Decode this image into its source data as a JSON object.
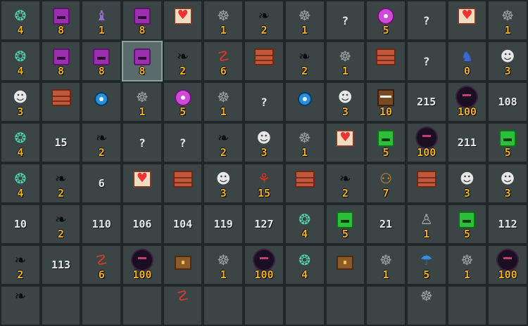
{
  "rows": [
    [
      {
        "icon": "gargoyle-icon",
        "value": "4"
      },
      {
        "icon": "purple-slime-icon",
        "value": "8"
      },
      {
        "icon": "robed-wizard-icon",
        "value": "1"
      },
      {
        "icon": "purple-slime-icon",
        "value": "8"
      },
      {
        "icon": "heart-icon",
        "value": ""
      },
      {
        "icon": "rat-icon",
        "value": "1"
      },
      {
        "icon": "bat-icon",
        "value": "2"
      },
      {
        "icon": "rat-icon",
        "value": "1"
      },
      {
        "icon": "",
        "value": "?"
      },
      {
        "icon": "pink-eye-icon",
        "value": "5"
      },
      {
        "icon": "",
        "value": "?"
      },
      {
        "icon": "heart-icon",
        "value": ""
      },
      {
        "icon": "rat-icon",
        "value": "1"
      }
    ],
    [
      {
        "icon": "gargoyle-icon",
        "value": "4"
      },
      {
        "icon": "purple-slime-icon",
        "value": "8"
      },
      {
        "icon": "purple-slime-icon",
        "value": "8"
      },
      {
        "icon": "purple-slime-icon",
        "value": "8",
        "selected": true
      },
      {
        "icon": "bat-icon",
        "value": "2"
      },
      {
        "icon": "red-serpent-icon",
        "value": "6"
      },
      {
        "icon": "brick-wall-icon",
        "value": ""
      },
      {
        "icon": "bat-icon",
        "value": "2"
      },
      {
        "icon": "rat-icon",
        "value": "1"
      },
      {
        "icon": "brick-wall-icon",
        "value": ""
      },
      {
        "icon": "",
        "value": "?"
      },
      {
        "icon": "knight-icon",
        "value": "0"
      },
      {
        "icon": "skeleton-icon",
        "value": "3"
      }
    ],
    [
      {
        "icon": "skeleton-icon",
        "value": "3"
      },
      {
        "icon": "brick-wall-icon",
        "value": ""
      },
      {
        "icon": "blue-eye-icon",
        "value": ""
      },
      {
        "icon": "rat-icon",
        "value": "1"
      },
      {
        "icon": "pink-eye-icon",
        "value": "5"
      },
      {
        "icon": "rat-icon",
        "value": "1"
      },
      {
        "icon": "",
        "value": "?"
      },
      {
        "icon": "blue-eye-icon",
        "value": ""
      },
      {
        "icon": "skeleton-icon",
        "value": "3"
      },
      {
        "icon": "mimic-chest-icon",
        "value": "10"
      },
      {
        "icon": "",
        "value": "215"
      },
      {
        "icon": "spiky-bomb-icon",
        "value": "100"
      },
      {
        "icon": "",
        "value": "108"
      }
    ],
    [
      {
        "icon": "gargoyle-icon",
        "value": "4"
      },
      {
        "icon": "",
        "value": "15"
      },
      {
        "icon": "bat-icon",
        "value": "2"
      },
      {
        "icon": "",
        "value": "?"
      },
      {
        "icon": "",
        "value": "?"
      },
      {
        "icon": "bat-icon",
        "value": "2"
      },
      {
        "icon": "skeleton-icon",
        "value": "3"
      },
      {
        "icon": "rat-icon",
        "value": "1"
      },
      {
        "icon": "heart-icon",
        "value": ""
      },
      {
        "icon": "green-slime-icon",
        "value": "5"
      },
      {
        "icon": "spiky-bomb-icon",
        "value": "100"
      },
      {
        "icon": "",
        "value": "211"
      },
      {
        "icon": "green-slime-icon",
        "value": "5"
      }
    ],
    [
      {
        "icon": "gargoyle-icon",
        "value": "4"
      },
      {
        "icon": "bat-icon",
        "value": "2"
      },
      {
        "icon": "",
        "value": "6"
      },
      {
        "icon": "heart-icon",
        "value": ""
      },
      {
        "icon": "brick-wall-icon",
        "value": ""
      },
      {
        "icon": "skeleton-icon",
        "value": "3"
      },
      {
        "icon": "red-dragon-icon",
        "value": "15"
      },
      {
        "icon": "brick-wall-icon",
        "value": ""
      },
      {
        "icon": "bat-icon",
        "value": "2"
      },
      {
        "icon": "orange-goblin-icon",
        "value": "7"
      },
      {
        "icon": "brick-wall-icon",
        "value": ""
      },
      {
        "icon": "skeleton-icon",
        "value": "3"
      },
      {
        "icon": "skeleton-icon",
        "value": "3"
      }
    ],
    [
      {
        "icon": "",
        "value": "10"
      },
      {
        "icon": "bat-icon",
        "value": "2"
      },
      {
        "icon": "",
        "value": "110"
      },
      {
        "icon": "",
        "value": "106"
      },
      {
        "icon": "",
        "value": "104"
      },
      {
        "icon": "",
        "value": "119"
      },
      {
        "icon": "",
        "value": "127"
      },
      {
        "icon": "gargoyle-icon",
        "value": "4"
      },
      {
        "icon": "green-slime-icon",
        "value": "5"
      },
      {
        "icon": "",
        "value": "21"
      },
      {
        "icon": "grey-rat-statue-icon",
        "value": "1"
      },
      {
        "icon": "green-slime-icon",
        "value": "5"
      },
      {
        "icon": "",
        "value": "112"
      }
    ],
    [
      {
        "icon": "bat-icon",
        "value": "2"
      },
      {
        "icon": "",
        "value": "113"
      },
      {
        "icon": "red-serpent-icon",
        "value": "6"
      },
      {
        "icon": "spiky-bomb-icon",
        "value": "100"
      },
      {
        "icon": "chest-icon",
        "value": ""
      },
      {
        "icon": "rat-icon",
        "value": "1"
      },
      {
        "icon": "spiky-bomb-icon",
        "value": "100"
      },
      {
        "icon": "gargoyle-icon",
        "value": "4"
      },
      {
        "icon": "chest-icon",
        "value": ""
      },
      {
        "icon": "rat-icon",
        "value": "1"
      },
      {
        "icon": "blue-beast-icon",
        "value": "5"
      },
      {
        "icon": "rat-icon",
        "value": "1"
      },
      {
        "icon": "spiky-bomb-icon",
        "value": "100"
      }
    ],
    [
      {
        "icon": "bat-icon",
        "value": ""
      },
      {
        "icon": "",
        "value": ""
      },
      {
        "icon": "",
        "value": ""
      },
      {
        "icon": "",
        "value": ""
      },
      {
        "icon": "red-serpent-icon",
        "value": ""
      },
      {
        "icon": "",
        "value": ""
      },
      {
        "icon": "",
        "value": ""
      },
      {
        "icon": "",
        "value": ""
      },
      {
        "icon": "",
        "value": ""
      },
      {
        "icon": "",
        "value": ""
      },
      {
        "icon": "rat-icon",
        "value": ""
      },
      {
        "icon": "",
        "value": ""
      },
      {
        "icon": "",
        "value": ""
      }
    ]
  ],
  "glyphs": {
    "gargoyle-icon": {
      "char": "❂",
      "color": "#4fd6b0"
    },
    "robed-wizard-icon": {
      "char": "♝",
      "color": "#9a6bd0"
    },
    "rat-icon": {
      "char": "☸",
      "color": "#9aa4a4"
    },
    "bat-icon": {
      "char": "❧",
      "color": "#0a0c0c"
    },
    "skeleton-icon": {
      "char": "☻",
      "color": "#e8e8e8"
    },
    "red-serpent-icon": {
      "char": "☡",
      "color": "#d83a2a"
    },
    "knight-icon": {
      "char": "♞",
      "color": "#3a6ad8"
    },
    "red-dragon-icon": {
      "char": "⚘",
      "color": "#e0301a"
    },
    "orange-goblin-icon": {
      "char": "⚇",
      "color": "#e08a2a"
    },
    "grey-rat-statue-icon": {
      "char": "♙",
      "color": "#a8b0b0"
    },
    "blue-beast-icon": {
      "char": "☂",
      "color": "#3a8ae0"
    }
  }
}
